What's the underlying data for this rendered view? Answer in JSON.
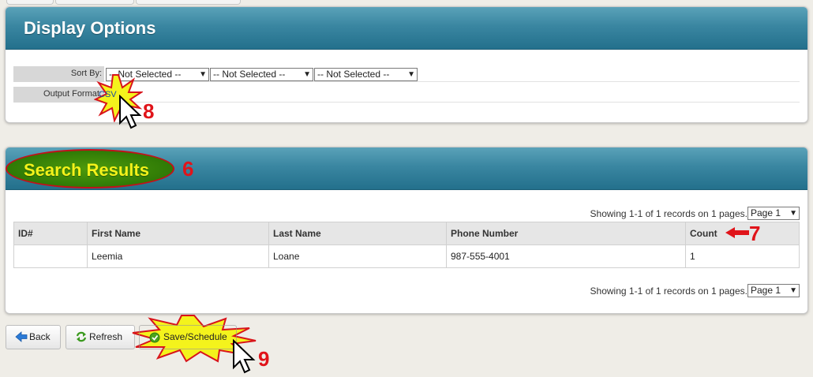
{
  "display_options": {
    "title": "Display Options",
    "sort_by_label": "Sort By:",
    "sort_selects": [
      "-- Not Selected --",
      "-- Not Selected --",
      "-- Not Selected --"
    ],
    "output_format_label": "Output Format:",
    "output_format_value": "CSV"
  },
  "search_results": {
    "title": "Search Results",
    "showing_text_top": "Showing 1-1 of 1 records on 1 pages.",
    "showing_text_bottom": "Showing 1-1 of 1 records on 1 pages.",
    "page_select_top": "Page 1",
    "page_select_bottom": "Page 1",
    "columns": [
      "ID#",
      "First Name",
      "Last Name",
      "Phone Number",
      "Count"
    ],
    "rows": [
      [
        "",
        "Leemia",
        "Loane",
        "987-555-4001",
        "1"
      ]
    ]
  },
  "buttons": {
    "back": "Back",
    "refresh": "Refresh",
    "save_schedule": "Save/Schedule"
  },
  "annotations": {
    "step_6": "6",
    "step_7": "7",
    "step_8": "8",
    "step_9": "9"
  },
  "colors": {
    "header_blue": "#3a86a1",
    "annotation_red": "#e0141a",
    "highlight_yellow": "#f3f21a",
    "results_green": "#2f7a06"
  }
}
